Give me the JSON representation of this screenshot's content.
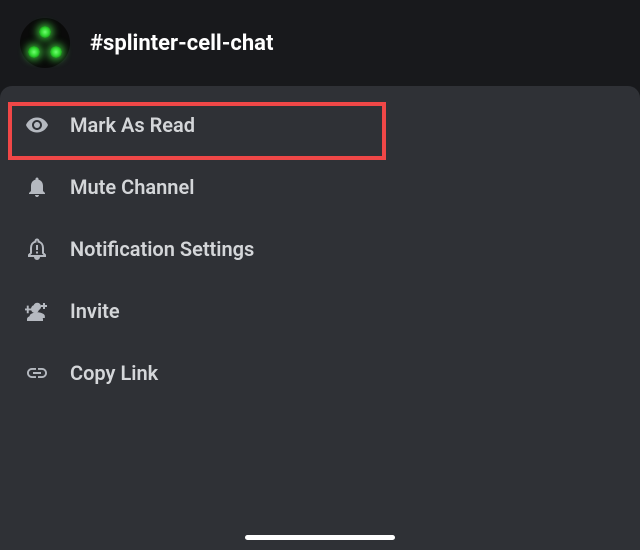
{
  "header": {
    "channel_name": "#splinter-cell-chat"
  },
  "menu": {
    "items": [
      {
        "label": "Mark As Read",
        "icon": "eye-icon"
      },
      {
        "label": "Mute Channel",
        "icon": "bell-icon"
      },
      {
        "label": "Notification Settings",
        "icon": "bell-alert-icon"
      },
      {
        "label": "Invite",
        "icon": "person-plus-icon"
      },
      {
        "label": "Copy Link",
        "icon": "link-icon"
      }
    ]
  },
  "highlight": {
    "target": "mark-as-read",
    "color": "#f04747"
  }
}
